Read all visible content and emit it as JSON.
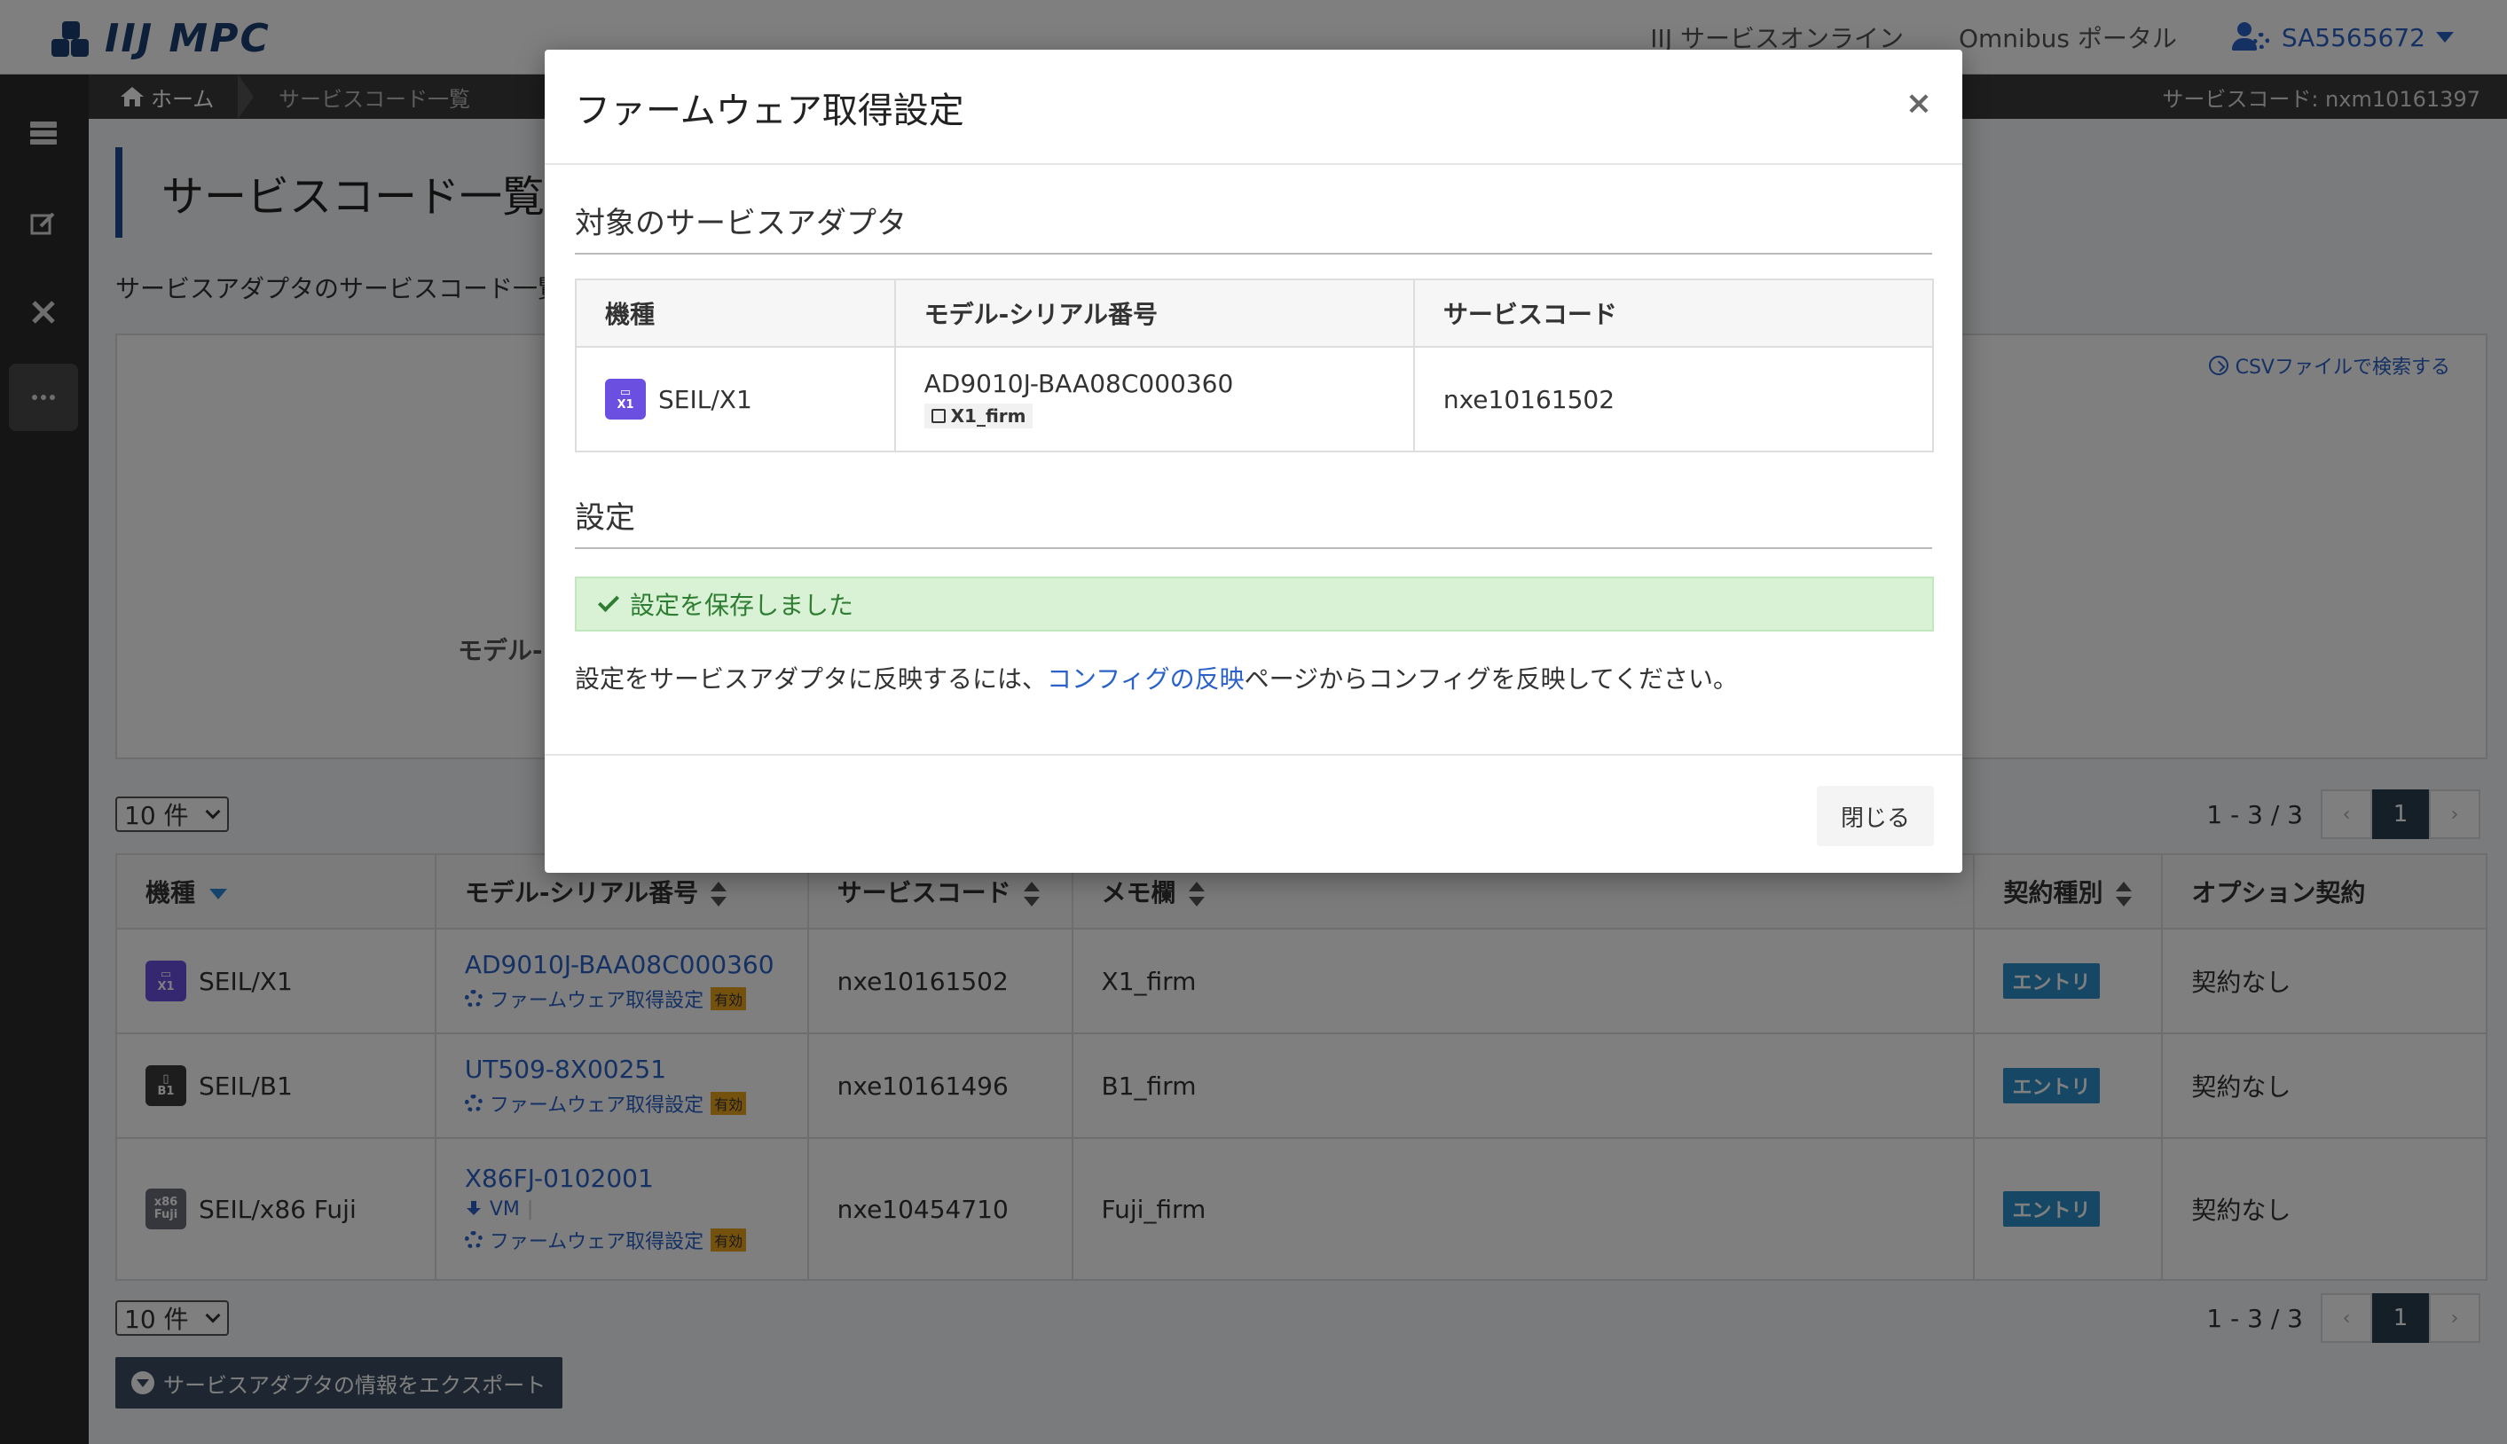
{
  "header": {
    "logo_text": "IIJ MPC",
    "links": [
      "IIJ サービスオンライン",
      "Omnibus ポータル"
    ],
    "user": "SA5565672"
  },
  "sidebar": {
    "items": [
      "server-icon",
      "edit-icon",
      "tools-icon",
      "more-icon"
    ]
  },
  "breadcrumb": {
    "home": "ホーム",
    "current": "サービスコード一覧",
    "service_code": "サービスコード: nxm10161397"
  },
  "page": {
    "title": "サービスコード一覧",
    "description": "サービスアダプタのサービスコード一覧",
    "csv_link": "CSVファイルで検索する",
    "search_label": "モデル-",
    "per_page": "10 件",
    "pager_info": "1 - 3 / 3",
    "current_page": "1",
    "prev": "‹",
    "next": "›",
    "export_button": "サービスアダプタの情報をエクスポート"
  },
  "table": {
    "headers": {
      "model": "機種",
      "serial": "モデル-シリアル番号",
      "service_code": "サービスコード",
      "memo": "メモ欄",
      "contract": "契約種別",
      "option": "オプション契約"
    },
    "rows": [
      {
        "icon_top": "▭",
        "icon_bottom": "X1",
        "model": "SEIL/X1",
        "serial": "AD9010J-BAA08C000360",
        "firmware": "ファームウェア取得設定",
        "firmware_badge": "有効",
        "service_code": "nxe10161502",
        "memo": "X1_firm",
        "contract": "エントリ",
        "option": "契約なし"
      },
      {
        "icon_top": "▯",
        "icon_bottom": "B1",
        "model": "SEIL/B1",
        "serial": "UT509-8X00251",
        "firmware": "ファームウェア取得設定",
        "firmware_badge": "有効",
        "service_code": "nxe10161496",
        "memo": "B1_firm",
        "contract": "エントリ",
        "option": "契約なし"
      },
      {
        "icon_top": "x86",
        "icon_bottom": "Fuji",
        "model": "SEIL/x86 Fuji",
        "serial": "X86FJ-0102001",
        "vm": "VM",
        "firmware": "ファームウェア取得設定",
        "firmware_badge": "有効",
        "service_code": "nxe10454710",
        "memo": "Fuji_firm",
        "contract": "エントリ",
        "option": "契約なし"
      }
    ]
  },
  "modal": {
    "title": "ファームウェア取得設定",
    "close_symbol": "×",
    "target_section": "対象のサービスアダプタ",
    "headers": {
      "model": "機種",
      "serial": "モデル-シリアル番号",
      "service_code": "サービスコード"
    },
    "row": {
      "icon_top": "▭",
      "icon_bottom": "X1",
      "model": "SEIL/X1",
      "serial": "AD9010J-BAA08C000360",
      "memo": "X1_firm",
      "service_code": "nxe10161502"
    },
    "settings_section": "設定",
    "success_message": "設定を保存しました",
    "info_before": "設定をサービスアダプタに反映するには、",
    "info_link": "コンフィグの反映",
    "info_after": "ページからコンフィグを反映してください。",
    "close_button": "閉じる"
  },
  "colors": {
    "accent": "#1d4f91",
    "link": "#2a62c9",
    "success_bg": "#d9f2d6",
    "entry_badge": "#2d8fc9",
    "valid_badge": "#e8a21b"
  }
}
